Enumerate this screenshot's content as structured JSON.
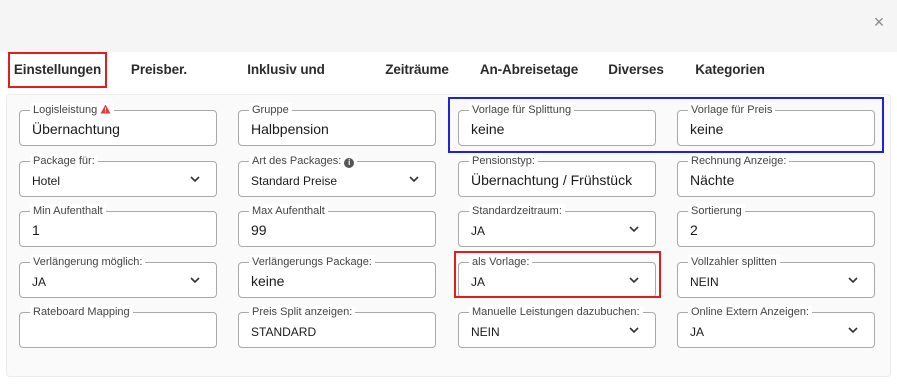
{
  "dialog": {
    "close_label": "×"
  },
  "tabs": [
    {
      "label": "Einstellungen",
      "active": true
    },
    {
      "label": "Preisber."
    },
    {
      "label": "Inklusiv und Abschläge"
    },
    {
      "label": "Zeiträume"
    },
    {
      "label": "An-Abreisetage"
    },
    {
      "label": "Diverses"
    },
    {
      "label": "Kategorien"
    }
  ],
  "fields": {
    "logisleistung": {
      "label": "Logisleistung",
      "value": "Übernachtung",
      "icon": "warning-icon",
      "icon_color": "#e53935"
    },
    "gruppe": {
      "label": "Gruppe",
      "value": "Halbpension"
    },
    "vorlage_splittung": {
      "label": "Vorlage für Splittung",
      "value": "keine"
    },
    "vorlage_preis": {
      "label": "Vorlage für Preis",
      "value": "keine"
    },
    "package_fuer": {
      "label": "Package für:",
      "value": "Hotel"
    },
    "art_des_packages": {
      "label": "Art des Packages:",
      "value": "Standard Preise",
      "icon": "info-icon"
    },
    "pensionstyp": {
      "label": "Pensionstyp:",
      "value": "Übernachtung / Frühstück"
    },
    "rechnung_anzeige": {
      "label": "Rechnung Anzeige:",
      "value": "Nächte"
    },
    "min_aufenthalt": {
      "label": "Min Aufenthalt",
      "value": "1"
    },
    "max_aufenthalt": {
      "label": "Max Aufenthalt",
      "value": "99"
    },
    "standardzeitraum": {
      "label": "Standardzeitraum:",
      "value": "JA"
    },
    "sortierung": {
      "label": "Sortierung",
      "value": "2"
    },
    "verlaengerung_moeglich": {
      "label": "Verlängerung möglich:",
      "value": "JA"
    },
    "verlaengerungs_package": {
      "label": "Verlängerungs Package:",
      "value": "keine"
    },
    "als_vorlage": {
      "label": "als Vorlage:",
      "value": "JA"
    },
    "vollzahler_splitten": {
      "label": "Vollzahler splitten",
      "value": "NEIN"
    },
    "rateboard_mapping": {
      "label": "Rateboard Mapping",
      "value": ""
    },
    "preis_split_anzeigen": {
      "label": "Preis Split anzeigen:",
      "value": "STANDARD"
    },
    "manuelle_leistungen": {
      "label": "Manuelle Leistungen dazubuchen:",
      "value": "NEIN"
    },
    "online_extern_anzeigen": {
      "label": "Online Extern Anzeigen:",
      "value": "JA"
    }
  },
  "colors": {
    "highlight_red": "#e01e1e",
    "highlight_blue": "#1f23d6"
  }
}
